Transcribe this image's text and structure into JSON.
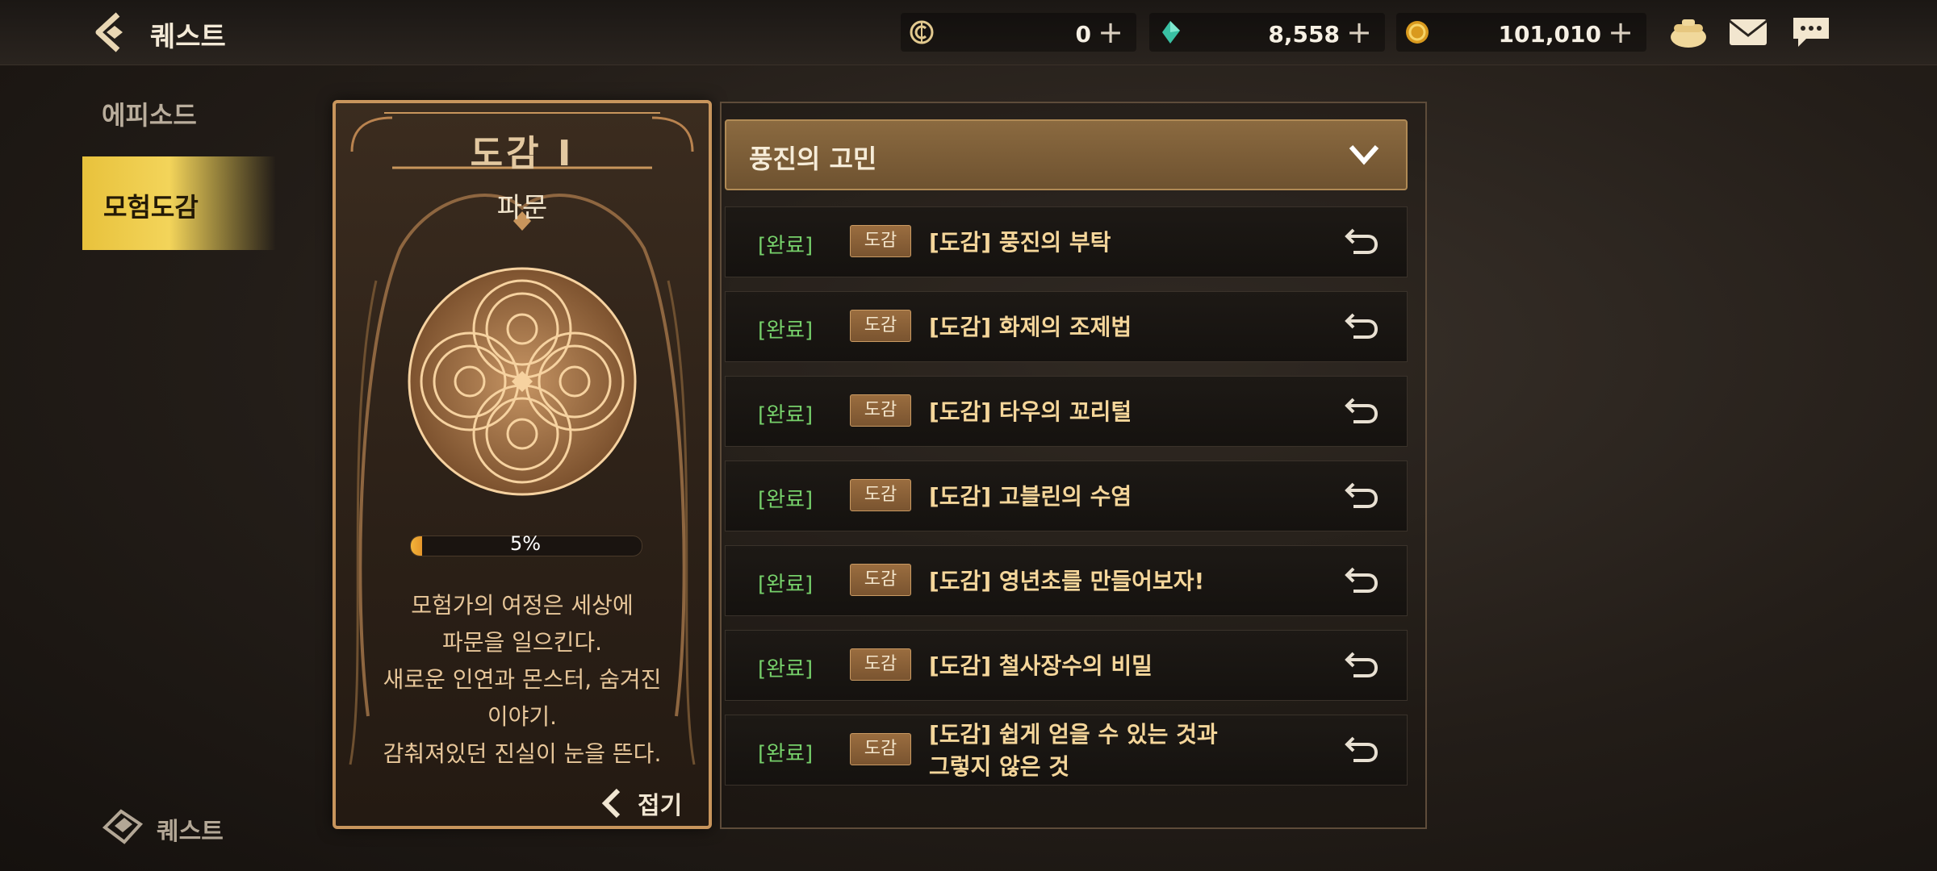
{
  "header": {
    "title": "퀘스트",
    "currencies": [
      {
        "icon": "c-coin-icon",
        "value": "0"
      },
      {
        "icon": "gem-icon",
        "value": "8,558"
      },
      {
        "icon": "gold-coin-icon",
        "value": "101,010"
      }
    ],
    "plus": "+"
  },
  "sidebar": {
    "items": [
      {
        "label": "에피소드",
        "active": false
      },
      {
        "label": "모험도감",
        "active": true
      }
    ],
    "bottom_label": "퀘스트"
  },
  "card": {
    "title": "도감 I",
    "subtitle": "파문",
    "progress_percent": 5,
    "progress_label": "5%",
    "description": "모험가의 여정은 세상에\n파문을 일으킨다.\n새로운 인연과 몬스터, 숨겨진\n이야기.\n감춰져있던 진실이 눈을 뜬다.",
    "fold_label": "접기"
  },
  "chapter": {
    "title": "풍진의 고민"
  },
  "quests": [
    {
      "status": "[완료]",
      "badge": "도감",
      "title": "[도감] 풍진의 부탁"
    },
    {
      "status": "[완료]",
      "badge": "도감",
      "title": "[도감] 화제의 조제법"
    },
    {
      "status": "[완료]",
      "badge": "도감",
      "title": "[도감] 타우의 꼬리털"
    },
    {
      "status": "[완료]",
      "badge": "도감",
      "title": "[도감] 고블린의 수염"
    },
    {
      "status": "[완료]",
      "badge": "도감",
      "title": "[도감] 영년초를 만들어보자!"
    },
    {
      "status": "[완료]",
      "badge": "도감",
      "title": "[도감] 철사장수의 비밀"
    },
    {
      "status": "[완료]",
      "badge": "도감",
      "title": "[도감] 쉽게 얻을 수 있는 것과\n그렇지 않은 것"
    }
  ],
  "colors": {
    "accent_gold": "#e8c23c",
    "complete_green": "#76d06a",
    "frame_bronze": "#c8955c"
  }
}
